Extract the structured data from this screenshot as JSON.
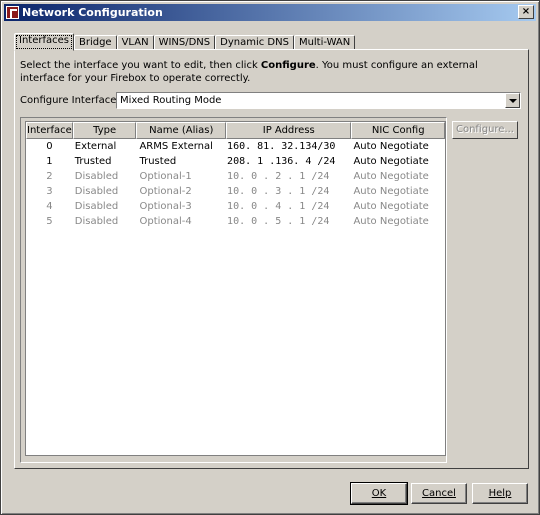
{
  "window": {
    "title": "Network Configuration",
    "close_glyph": "×"
  },
  "tabs": [
    {
      "label": "Interfaces",
      "active": true
    },
    {
      "label": "Bridge"
    },
    {
      "label": "VLAN"
    },
    {
      "label": "WINS/DNS"
    },
    {
      "label": "Dynamic DNS"
    },
    {
      "label": "Multi-WAN"
    }
  ],
  "instructions": {
    "prefix": "Select the interface you want to edit, then click ",
    "bold": "Configure",
    "suffix": ". You must configure an external interface for your Firebox to operate correctly."
  },
  "configure_mode": {
    "label": "Configure Interfaces in",
    "value": "Mixed Routing Mode"
  },
  "table": {
    "columns": [
      "Interface",
      "Type",
      "Name (Alias)",
      "IP Address",
      "NIC Config"
    ],
    "rows": [
      [
        "0",
        "External",
        "ARMS External",
        "160. 81. 32.134/30",
        "Auto Negotiate"
      ],
      [
        "1",
        "Trusted",
        "Trusted",
        "208. 1 .136. 4 /24",
        "Auto Negotiate"
      ],
      [
        "2",
        "Disabled",
        "Optional-1",
        "10. 0 . 2 . 1 /24",
        "Auto Negotiate"
      ],
      [
        "3",
        "Disabled",
        "Optional-2",
        "10. 0 . 3 . 1 /24",
        "Auto Negotiate"
      ],
      [
        "4",
        "Disabled",
        "Optional-3",
        "10. 0 . 4 . 1 /24",
        "Auto Negotiate"
      ],
      [
        "5",
        "Disabled",
        "Optional-4",
        "10. 0 . 5 . 1 /24",
        "Auto Negotiate"
      ]
    ]
  },
  "buttons": {
    "configure": "Configure...",
    "ok": "OK",
    "cancel": "Cancel",
    "help": "Help"
  }
}
